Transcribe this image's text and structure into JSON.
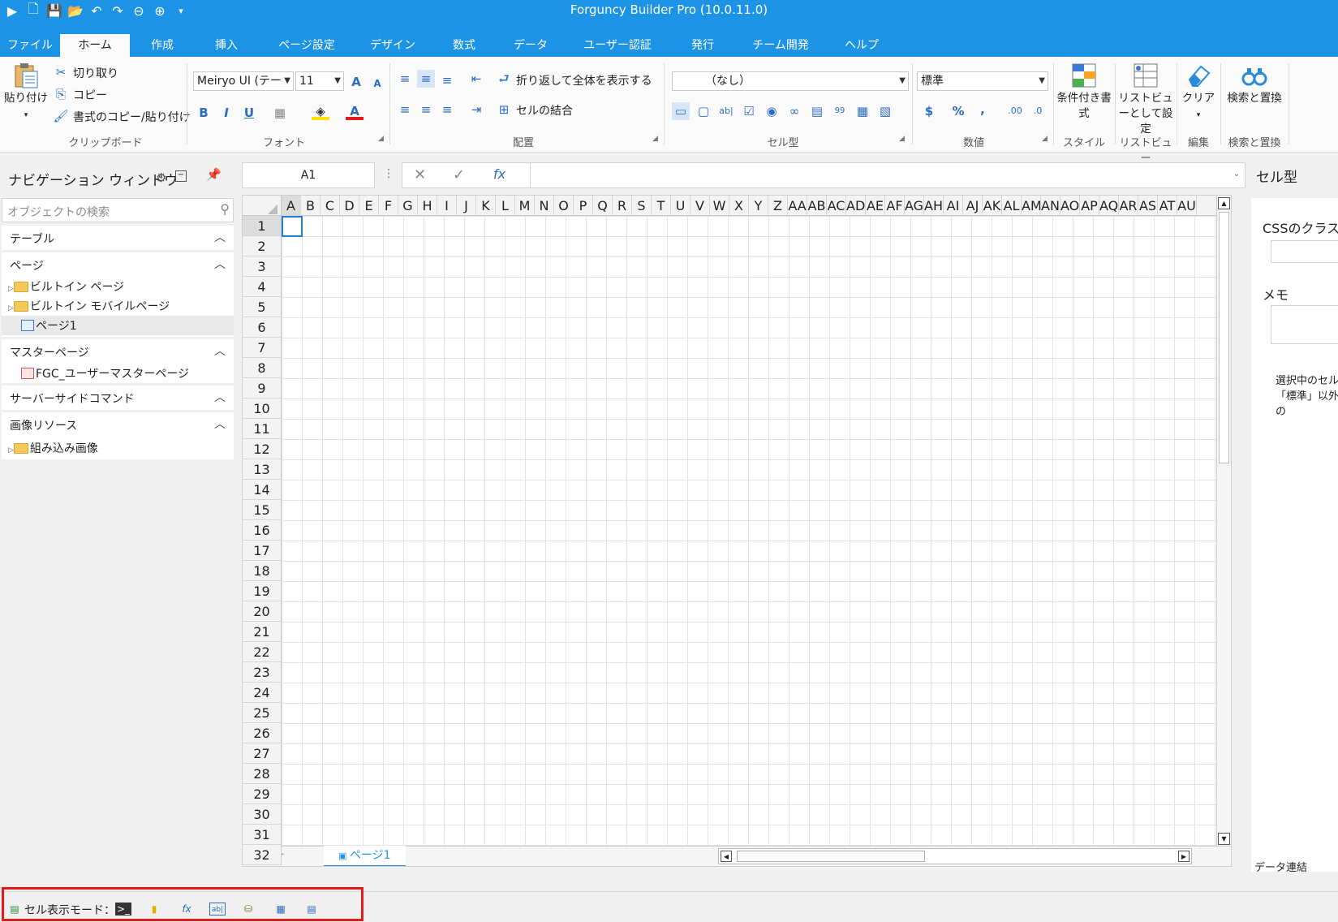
{
  "app": {
    "title": "Forguncy Builder Pro (10.0.11.0)"
  },
  "tabs": [
    "ファイル",
    "ホーム",
    "作成",
    "挿入",
    "ページ設定",
    "デザイン",
    "数式",
    "データ",
    "ユーザー認証",
    "発行",
    "チーム開発",
    "ヘルプ"
  ],
  "ribbon": {
    "clipboard": {
      "paste": "貼り付け",
      "cut": "切り取り",
      "copy": "コピー",
      "format_painter": "書式のコピー/貼り付け",
      "label": "クリップボード"
    },
    "font": {
      "family": "Meiryo UI (テー",
      "size": "11",
      "label": "フォント",
      "bold": "B",
      "italic": "I",
      "underline": "U"
    },
    "alignment": {
      "wrap": "折り返して全体を表示する",
      "merge": "セルの結合",
      "label": "配置"
    },
    "celltype": {
      "value": "（なし）",
      "label": "セル型"
    },
    "number": {
      "format": "標準",
      "label": "数値"
    },
    "style": {
      "cond_format": "条件付き書式",
      "label": "スタイル"
    },
    "listview": {
      "set": "リストビューとして設定",
      "label": "リストビュー"
    },
    "edit": {
      "clear": "クリア",
      "label": "編集"
    },
    "find": {
      "replace": "検索と置換",
      "label": "検索と置換"
    }
  },
  "nav": {
    "title": "ナビゲーション ウィンドウ",
    "search_placeholder": "オブジェクトの検索",
    "sections": {
      "table": "テーブル",
      "page": "ページ",
      "master": "マスターページ",
      "server": "サーバーサイドコマンド",
      "images": "画像リソース"
    },
    "items": {
      "builtin_page": "ビルトイン ページ",
      "builtin_mobile": "ビルトイン モバイルページ",
      "page1": "ページ1",
      "fgc_master": "FGC_ユーザーマスターページ",
      "builtin_images": "組み込み画像"
    }
  },
  "formula": {
    "namebox": "A1",
    "value": ""
  },
  "grid": {
    "columns": [
      "A",
      "B",
      "C",
      "D",
      "E",
      "F",
      "G",
      "H",
      "I",
      "J",
      "K",
      "L",
      "M",
      "N",
      "O",
      "P",
      "Q",
      "R",
      "S",
      "T",
      "U",
      "V",
      "W",
      "X",
      "Y",
      "Z",
      "AA",
      "AB",
      "AC",
      "AD",
      "AE",
      "AF",
      "AG",
      "AH",
      "AI",
      "AJ",
      "AK",
      "AL",
      "AM",
      "AN",
      "AO",
      "AP",
      "AQ",
      "AR",
      "AS",
      "AT",
      "AU"
    ],
    "rows": [
      "1",
      "2",
      "3",
      "4",
      "5",
      "6",
      "7",
      "8",
      "9",
      "10",
      "11",
      "12",
      "13",
      "14",
      "15",
      "16",
      "17",
      "18",
      "19",
      "20",
      "21",
      "22",
      "23",
      "24",
      "25",
      "26",
      "27",
      "28",
      "29",
      "30",
      "31",
      "32"
    ],
    "selected": "A1",
    "sheet_tab": "ページ1"
  },
  "rightpane": {
    "title": "セル型",
    "css_class": "CSSのクラス",
    "memo": "メモ",
    "note": "選択中のセル「標準」以外の",
    "tab": "データ連結"
  },
  "status": {
    "cell_display_mode": "セル表示モード："
  },
  "colors": {
    "accent": "#1c93e5",
    "highlight": "#e31b1b"
  }
}
